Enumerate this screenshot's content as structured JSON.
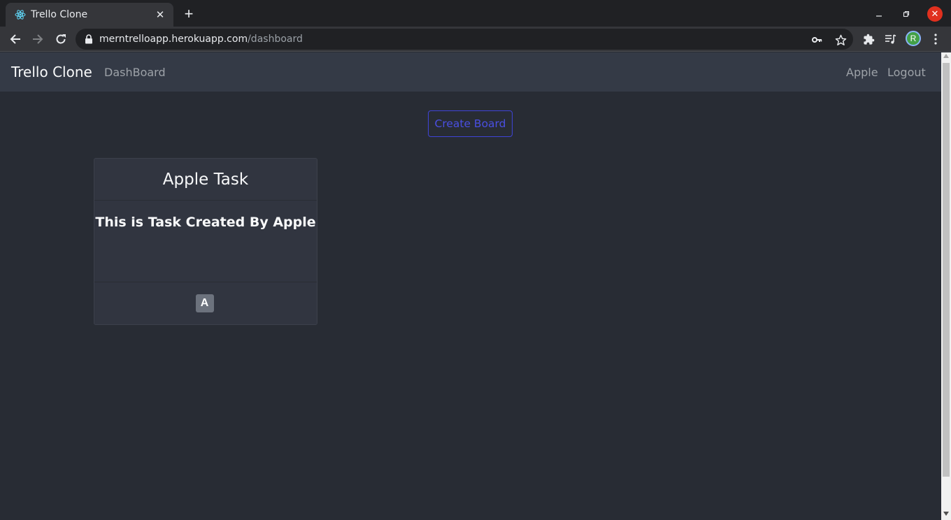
{
  "browser": {
    "tab_title": "Trello Clone",
    "url_host": "merntrelloapp.herokuapp.com",
    "url_path": "/dashboard",
    "profile_initial": "R"
  },
  "navbar": {
    "brand": "Trello Clone",
    "dashboard_link": "DashBoard",
    "user_link": "Apple",
    "logout_link": "Logout"
  },
  "main": {
    "create_board_label": "Create Board",
    "boards": [
      {
        "title": "Apple Task",
        "description": "This is Task Created By Apple",
        "member_initial": "A"
      }
    ]
  },
  "colors": {
    "page_bg": "#282c34",
    "navbar_bg": "#343a46",
    "accent": "#3f44d8"
  }
}
